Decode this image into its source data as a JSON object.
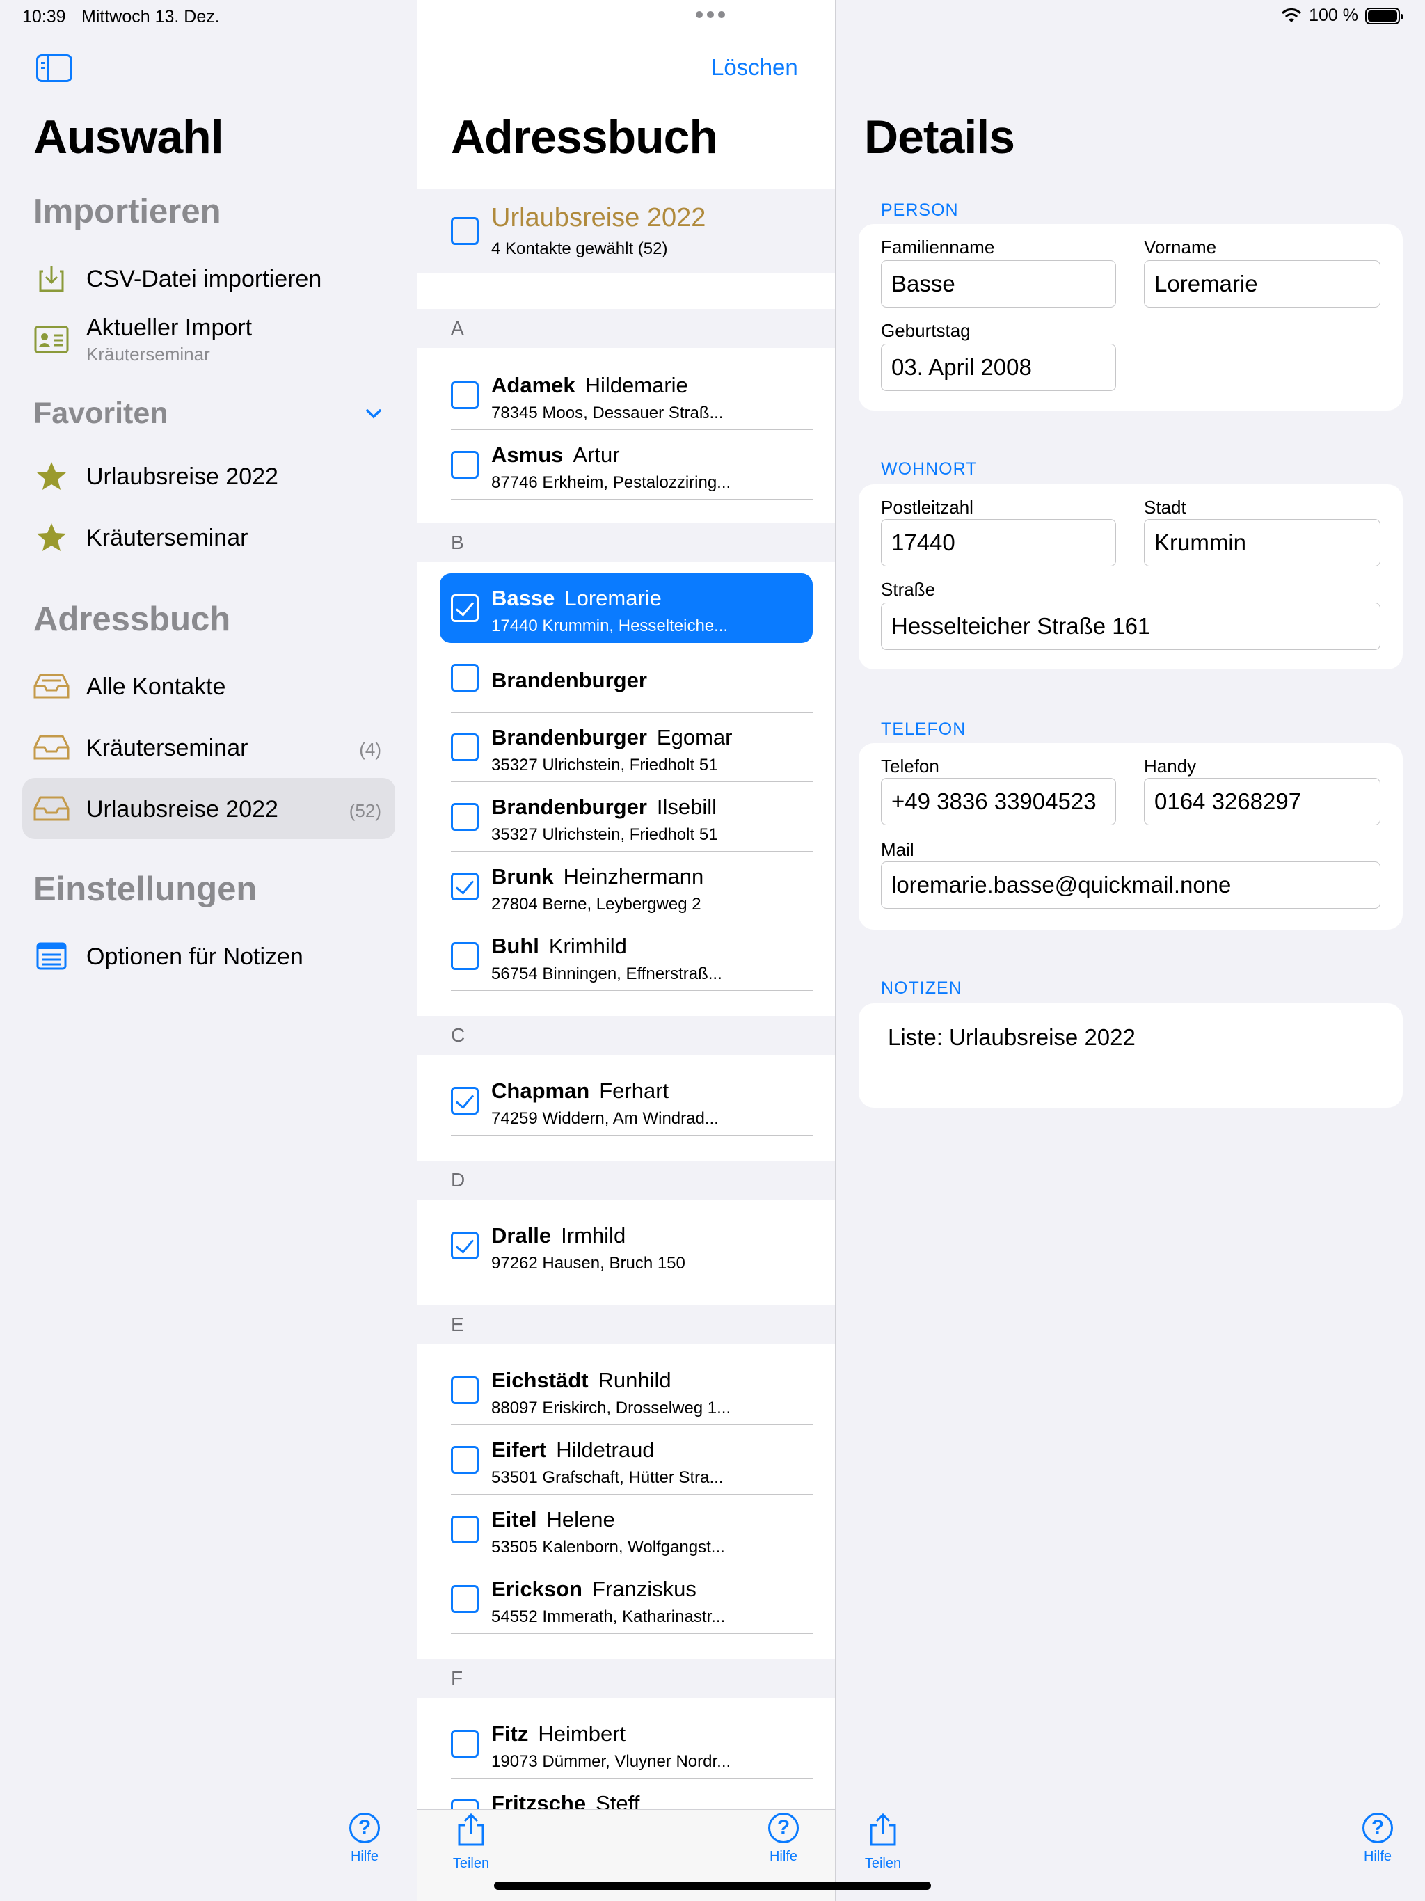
{
  "status": {
    "time": "10:39",
    "date": "Mittwoch 13. Dez.",
    "battery": "100 %"
  },
  "sidebar": {
    "title": "Auswahl",
    "import_header": "Importieren",
    "import_items": [
      {
        "label": "CSV-Datei importieren",
        "icon": "import-tray-icon"
      },
      {
        "label": "Aktueller Import",
        "sub": "Kräuterseminar",
        "icon": "contact-card-icon"
      }
    ],
    "favorites_header": "Favoriten",
    "favorites": [
      {
        "label": "Urlaubsreise 2022",
        "icon": "star-icon"
      },
      {
        "label": "Kräuterseminar",
        "icon": "star-icon"
      }
    ],
    "addressbook_header": "Adressbuch",
    "addressbook_items": [
      {
        "label": "Alle Kontakte",
        "count": ""
      },
      {
        "label": "Kräuterseminar",
        "count": "(4)"
      },
      {
        "label": "Urlaubsreise 2022",
        "count": "(52)"
      }
    ],
    "settings_header": "Einstellungen",
    "settings_items": [
      {
        "label": "Optionen für Notizen"
      }
    ],
    "help_label": "Hilfe"
  },
  "list": {
    "title": "Adressbuch",
    "delete_label": "Löschen",
    "group": {
      "title": "Urlaubsreise 2022",
      "subtitle": "4 Kontakte gewählt (52)"
    },
    "letters": [
      "A",
      "B",
      "C",
      "D",
      "E",
      "F"
    ],
    "contacts": [
      {
        "last": "Adamek",
        "first": "Hildemarie",
        "address": "78345 Moos, Dessauer Straß...",
        "checked": false
      },
      {
        "last": "Asmus",
        "first": "Artur",
        "address": "87746 Erkheim, Pestalozziring...",
        "checked": false
      },
      {
        "last": "Basse",
        "first": "Loremarie",
        "address": "17440 Krummin, Hesselteiche...",
        "checked": true,
        "selected": true
      },
      {
        "last": "Brandenburger",
        "first": "",
        "address": "",
        "checked": false
      },
      {
        "last": "Brandenburger",
        "first": "Egomar",
        "address": "35327 Ulrichstein, Friedholt 51",
        "checked": false
      },
      {
        "last": "Brandenburger",
        "first": "Ilsebill",
        "address": "35327 Ulrichstein, Friedholt 51",
        "checked": false
      },
      {
        "last": "Brunk",
        "first": "Heinzhermann",
        "address": "27804 Berne, Leybergweg 2",
        "checked": true
      },
      {
        "last": "Buhl",
        "first": "Krimhild",
        "address": "56754 Binningen, Effnerstraß...",
        "checked": false
      },
      {
        "last": "Chapman",
        "first": "Ferhart",
        "address": "74259 Widdern, Am Windrad...",
        "checked": true
      },
      {
        "last": "Dralle",
        "first": "Irmhild",
        "address": "97262 Hausen, Bruch 150",
        "checked": true
      },
      {
        "last": "Eichstädt",
        "first": "Runhild",
        "address": "88097 Eriskirch, Drosselweg 1...",
        "checked": false
      },
      {
        "last": "Eifert",
        "first": "Hildetraud",
        "address": "53501 Grafschaft, Hütter Stra...",
        "checked": false
      },
      {
        "last": "Eitel",
        "first": "Helene",
        "address": "53505 Kalenborn, Wolfgangst...",
        "checked": false
      },
      {
        "last": "Erickson",
        "first": "Franziskus",
        "address": "54552 Immerath, Katharinastr...",
        "checked": false
      },
      {
        "last": "Fitz",
        "first": "Heimbert",
        "address": "19073 Dümmer, Vluyner Nordr...",
        "checked": false
      },
      {
        "last": "Fritzsche",
        "first": "Steff",
        "address": "",
        "checked": false
      }
    ],
    "share_label": "Teilen",
    "help_label": "Hilfe"
  },
  "details": {
    "title": "Details",
    "person_header": "PERSON",
    "lastname_label": "Familienname",
    "lastname": "Basse",
    "firstname_label": "Vorname",
    "firstname": "Loremarie",
    "birthday_label": "Geburtstag",
    "birthday": "03. April 2008",
    "residence_header": "WOHNORT",
    "zip_label": "Postleitzahl",
    "zip": "17440",
    "city_label": "Stadt",
    "city": "Krummin",
    "street_label": "Straße",
    "street": "Hesselteicher Straße 161",
    "phone_header": "TELEFON",
    "phone_label": "Telefon",
    "phone": "+49 3836 33904523",
    "mobile_label": "Handy",
    "mobile": "0164 3268297",
    "mail_label": "Mail",
    "mail": "loremarie.basse@quickmail.none",
    "notes_header": "NOTIZEN",
    "notes": "Liste: Urlaubsreise 2022",
    "share_label": "Teilen",
    "help_label": "Hilfe"
  },
  "colors": {
    "accent": "#0a7bff",
    "favorite": "#9a9a2e",
    "group_title": "#b08a3c",
    "tray": "#c49a4a",
    "import_icon": "#8b9a3a"
  }
}
